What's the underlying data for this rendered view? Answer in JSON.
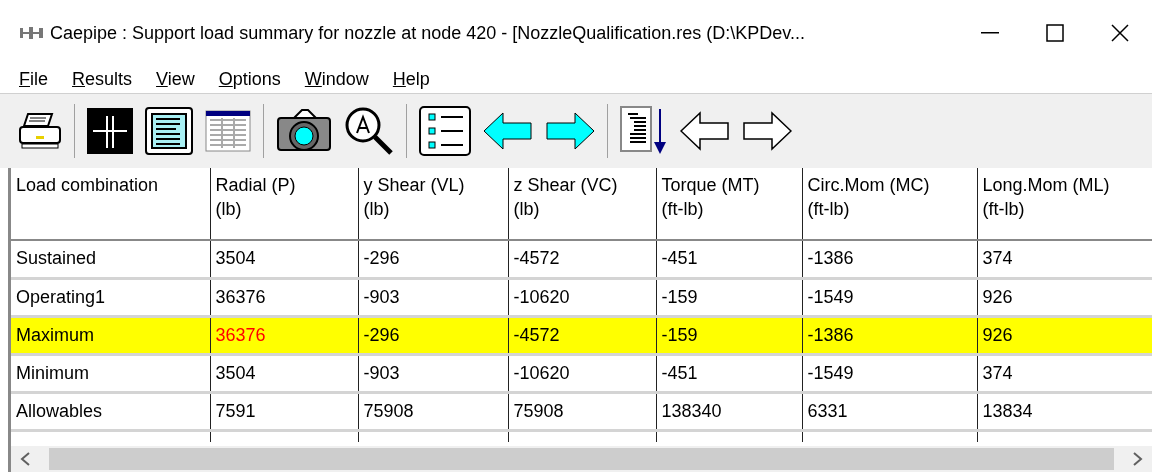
{
  "window": {
    "title": "Caepipe : Support load summary for nozzle at node 420 -  [NozzleQualification.res (D:\\KPDev..."
  },
  "menu": [
    "File",
    "Results",
    "View",
    "Options",
    "Window",
    "Help"
  ],
  "table": {
    "columns": [
      "Load combination",
      "Radial (P)\n(lb)",
      "y Shear (VL)\n(lb)",
      "z Shear (VC)\n(lb)",
      "Torque (MT)\n(ft-lb)",
      "Circ.Mom (MC)\n(ft-lb)",
      "Long.Mom (ML)\n(ft-lb)"
    ],
    "rows": [
      {
        "highlighted": false,
        "cells": [
          {
            "text": "Sustained",
            "alert": false
          },
          {
            "text": "3504",
            "alert": false
          },
          {
            "text": "-296",
            "alert": false
          },
          {
            "text": "-4572",
            "alert": false
          },
          {
            "text": "-451",
            "alert": false
          },
          {
            "text": "-1386",
            "alert": false
          },
          {
            "text": "374",
            "alert": false
          }
        ]
      },
      {
        "highlighted": false,
        "cells": [
          {
            "text": "Operating1",
            "alert": false
          },
          {
            "text": "36376",
            "alert": false
          },
          {
            "text": "-903",
            "alert": false
          },
          {
            "text": "-10620",
            "alert": false
          },
          {
            "text": "-159",
            "alert": false
          },
          {
            "text": "-1549",
            "alert": false
          },
          {
            "text": "926",
            "alert": false
          }
        ]
      },
      {
        "highlighted": true,
        "cells": [
          {
            "text": "Maximum",
            "alert": false
          },
          {
            "text": "36376",
            "alert": true
          },
          {
            "text": "-296",
            "alert": false
          },
          {
            "text": "-4572",
            "alert": false
          },
          {
            "text": "-159",
            "alert": false
          },
          {
            "text": "-1386",
            "alert": false
          },
          {
            "text": "926",
            "alert": false
          }
        ]
      },
      {
        "highlighted": false,
        "cells": [
          {
            "text": "Minimum",
            "alert": false
          },
          {
            "text": "3504",
            "alert": false
          },
          {
            "text": "-903",
            "alert": false
          },
          {
            "text": "-10620",
            "alert": false
          },
          {
            "text": "-451",
            "alert": false
          },
          {
            "text": "-1549",
            "alert": false
          },
          {
            "text": "374",
            "alert": false
          }
        ]
      },
      {
        "highlighted": false,
        "cells": [
          {
            "text": "Allowables",
            "alert": false
          },
          {
            "text": "7591",
            "alert": false
          },
          {
            "text": "75908",
            "alert": false
          },
          {
            "text": "75908",
            "alert": false
          },
          {
            "text": "138340",
            "alert": false
          },
          {
            "text": "6331",
            "alert": false
          },
          {
            "text": "13834",
            "alert": false
          }
        ]
      }
    ]
  }
}
